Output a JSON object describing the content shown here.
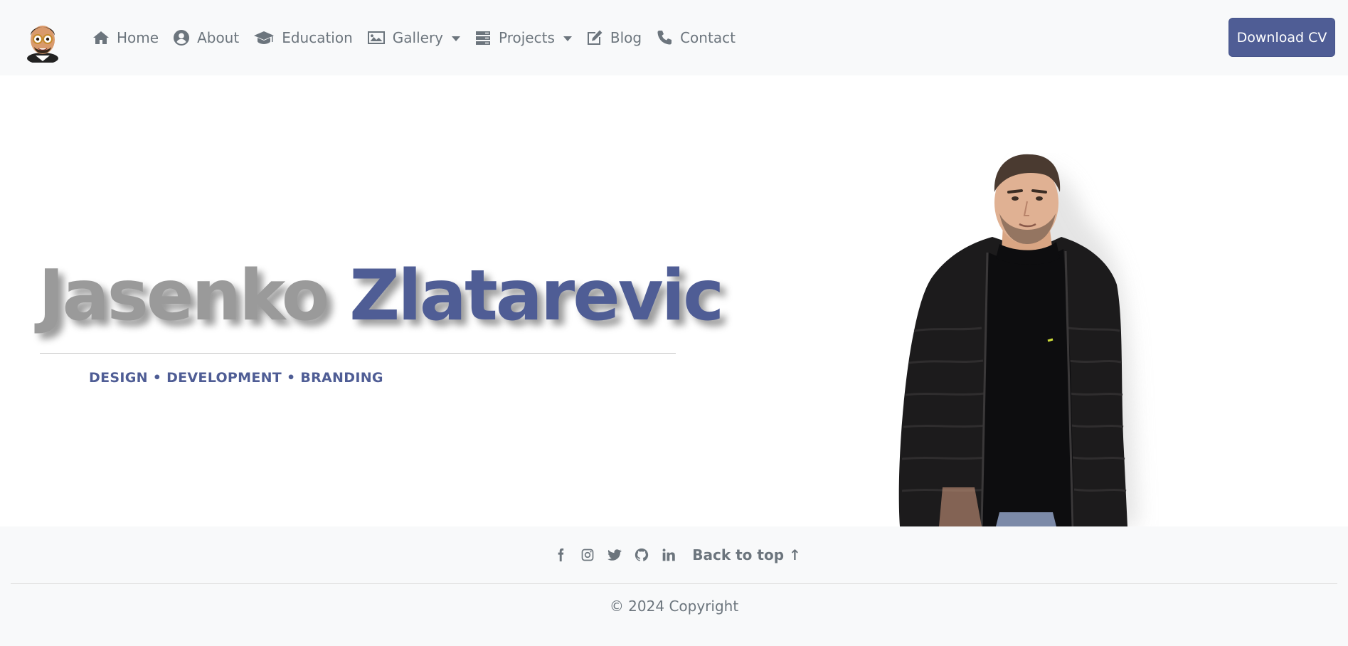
{
  "nav": {
    "items": [
      {
        "label": "Home",
        "icon": "home-icon"
      },
      {
        "label": "About",
        "icon": "user-circle-icon"
      },
      {
        "label": "Education",
        "icon": "graduation-cap-icon"
      },
      {
        "label": "Gallery",
        "icon": "image-icon",
        "dropdown": true
      },
      {
        "label": "Projects",
        "icon": "server-icon",
        "dropdown": true
      },
      {
        "label": "Blog",
        "icon": "edit-icon"
      },
      {
        "label": "Contact",
        "icon": "phone-icon"
      }
    ],
    "cta_label": "Download CV"
  },
  "hero": {
    "first_name": "Jasenko",
    "last_name": "Zlatarevic",
    "tagline": "DESIGN • DEVELOPMENT • BRANDING"
  },
  "footer": {
    "social": [
      "facebook-icon",
      "instagram-icon",
      "twitter-icon",
      "github-icon",
      "linkedin-icon"
    ],
    "back_to_top": "Back to top ↑",
    "copyright": "© 2024 Copyright"
  },
  "colors": {
    "accent": "#4f5d95",
    "muted": "#6c757d",
    "surface": "#f8f9fa"
  }
}
